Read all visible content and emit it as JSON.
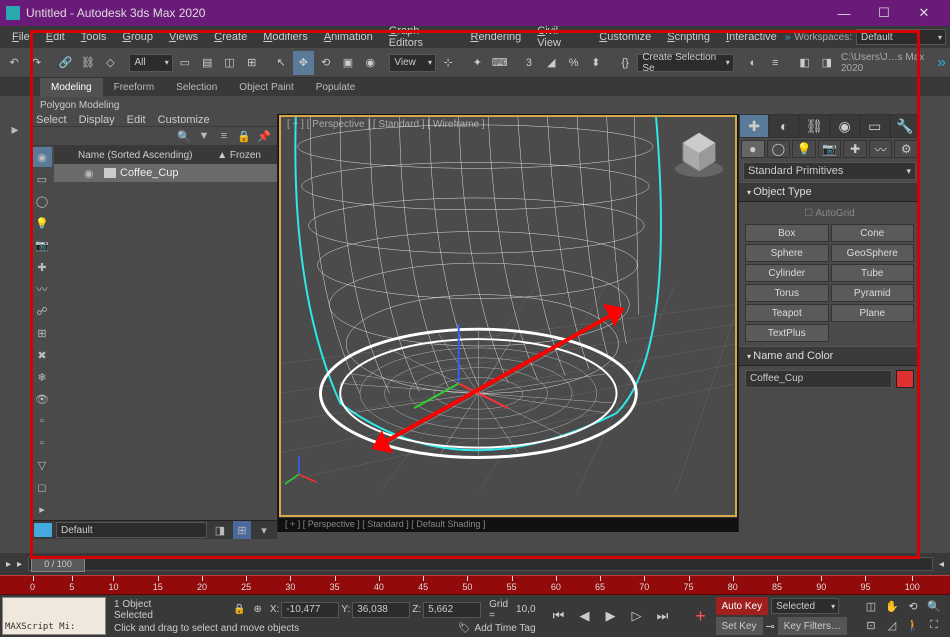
{
  "title": "Untitled - Autodesk 3ds Max 2020",
  "menu": [
    "File",
    "Edit",
    "Tools",
    "Group",
    "Views",
    "Create",
    "Modifiers",
    "Animation",
    "Graph Editors",
    "Rendering",
    "Civil View",
    "Customize",
    "Scripting",
    "Interactive"
  ],
  "workspace": {
    "label": "Workspaces:",
    "value": "Default"
  },
  "toolbar": {
    "all_dd": "All",
    "view_dd": "View",
    "selset_dd": "Create Selection Se",
    "path": "C:\\Users\\J…s Max 2020"
  },
  "ribbon": {
    "tabs": [
      "Modeling",
      "Freeform",
      "Selection",
      "Object Paint",
      "Populate"
    ],
    "sub": "Polygon Modeling"
  },
  "scene_panel": {
    "menu": [
      "Select",
      "Display",
      "Edit",
      "Customize"
    ],
    "header": {
      "col1": "Name (Sorted Ascending)",
      "col2": "▲ Frozen"
    },
    "items": [
      {
        "name": "Coffee_Cup"
      }
    ],
    "layer_dd": "Default"
  },
  "viewport": {
    "label1": "[ + ] [ Perspective ] [ Standard ] [ Wireframe ]",
    "label2": "[ + ] [ Perspective ] [ Standard ] [ Default Shading ]"
  },
  "cmd": {
    "category_dd": "Standard Primitives",
    "rollouts": {
      "object_type": "Object Type",
      "name_color": "Name and Color"
    },
    "autogrid": "AutoGrid",
    "buttons": [
      "Box",
      "Cone",
      "Sphere",
      "GeoSphere",
      "Cylinder",
      "Tube",
      "Torus",
      "Pyramid",
      "Teapot",
      "Plane",
      "TextPlus",
      ""
    ],
    "name_value": "Coffee_Cup"
  },
  "timeline": {
    "frame": "0 / 100",
    "ticks": [
      "0",
      "5",
      "10",
      "15",
      "20",
      "25",
      "30",
      "35",
      "40",
      "45",
      "50",
      "55",
      "60",
      "65",
      "70",
      "75",
      "80",
      "85",
      "90",
      "95",
      "100"
    ]
  },
  "status": {
    "selection": "1 Object Selected",
    "hint": "Click and drag to select and move objects",
    "script": "MAXScript Mi:",
    "coords": {
      "x_label": "X:",
      "x": "-10,477",
      "y_label": "Y:",
      "y": "36,038",
      "z_label": "Z:",
      "z": "5,662",
      "grid_label": "Grid =",
      "grid": "10,0"
    },
    "add_tag": "Add Time Tag",
    "autokey": "Auto Key",
    "setkey": "Set Key",
    "sel_dd": "Selected",
    "keyfilters": "Key Filters…"
  }
}
